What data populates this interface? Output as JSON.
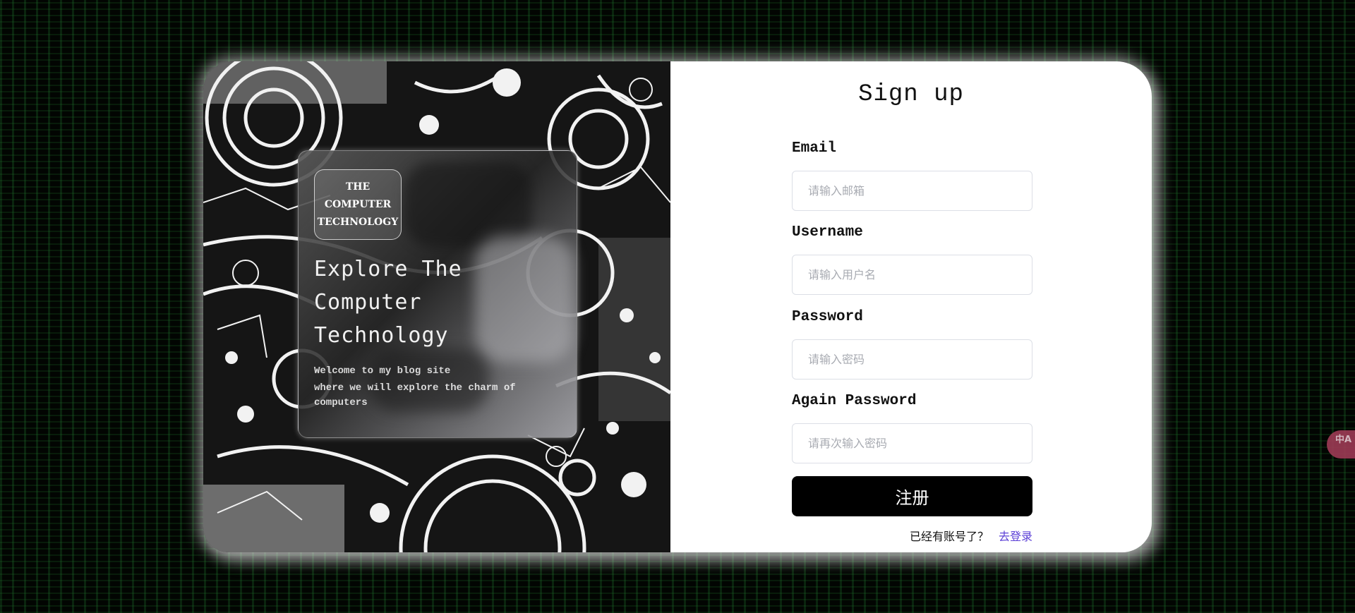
{
  "brand": {
    "logo_lines": [
      "THE",
      "COMPUTER",
      "TECHNOLOGY"
    ]
  },
  "hero": {
    "headline_lines": [
      "Explore The",
      "Computer",
      "Technology"
    ],
    "welcome_lines": [
      "Welcome to my blog site",
      "where we will explore the charm of",
      "computers"
    ]
  },
  "form": {
    "title": "Sign up",
    "email": {
      "label": "Email",
      "placeholder": "请输入邮箱",
      "value": ""
    },
    "username": {
      "label": "Username",
      "placeholder": "请输入用户名",
      "value": ""
    },
    "password": {
      "label": "Password",
      "placeholder": "请输入密码",
      "value": ""
    },
    "again_password": {
      "label": "Again Password",
      "placeholder": "请再次输入密码",
      "value": ""
    },
    "submit_label": "注册",
    "has_account_text": "已经有账号了？",
    "login_link_text": "去登录"
  },
  "translate_widget": {
    "icon": "translate-icon",
    "glyph": "中A"
  },
  "colors": {
    "background": "#000000",
    "card": "#ffffff",
    "submit_bg": "#000000",
    "link": "#5b3fd6",
    "translate_fab": "#9d3b55"
  }
}
